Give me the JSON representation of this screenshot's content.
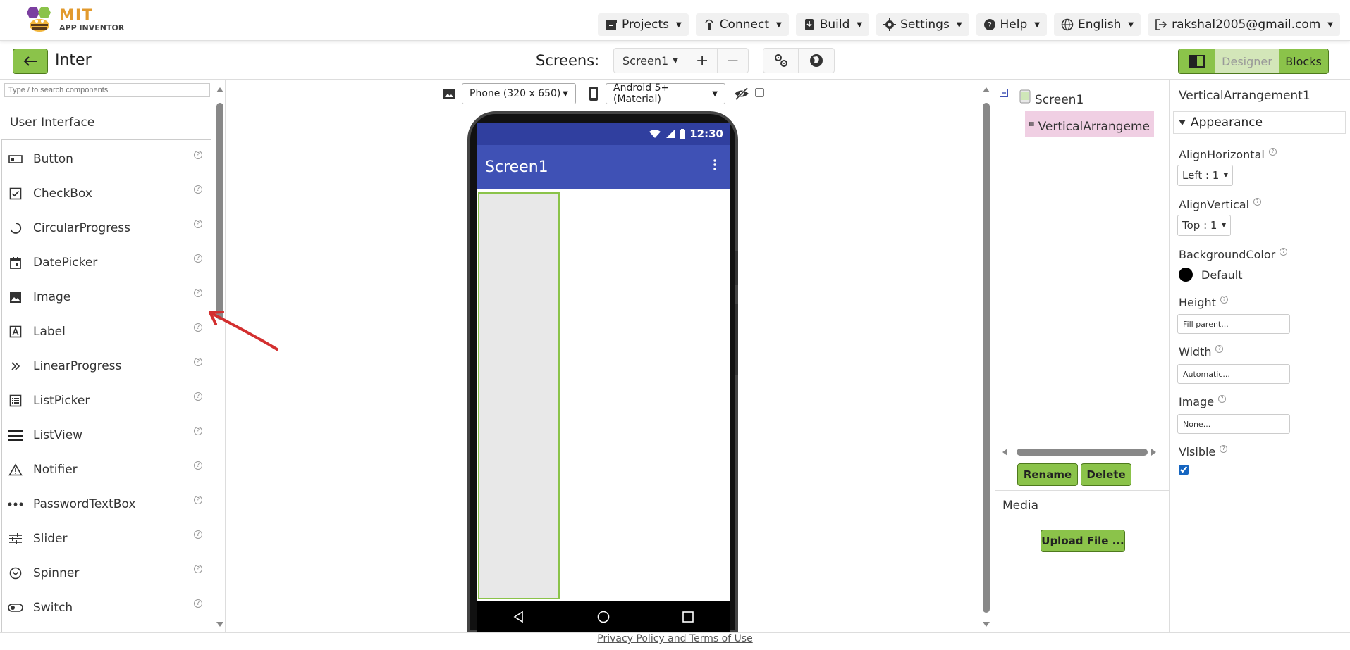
{
  "topbar": {
    "logo_mit": "MIT",
    "logo_sub": "APP INVENTOR",
    "nav": [
      {
        "label": "Projects",
        "icon": "archive-icon"
      },
      {
        "label": "Connect",
        "icon": "antenna-icon"
      },
      {
        "label": "Build",
        "icon": "download-box-icon"
      },
      {
        "label": "Settings",
        "icon": "gear-icon"
      },
      {
        "label": "Help",
        "icon": "help-circle-icon"
      },
      {
        "label": "English",
        "icon": "globe-icon"
      },
      {
        "label": "rakshal2005@gmail.com",
        "icon": "logout-icon"
      }
    ]
  },
  "toolbar": {
    "project_name": "Inter",
    "screens_label": "Screens:",
    "current_screen": "Screen1",
    "add": "+",
    "remove": "−",
    "designer": "Designer",
    "blocks": "Blocks"
  },
  "palette": {
    "search_placeholder": "Type / to search components",
    "category": "User Interface",
    "components": [
      {
        "label": "Button",
        "icon": "button-icon"
      },
      {
        "label": "CheckBox",
        "icon": "checkbox-icon"
      },
      {
        "label": "CircularProgress",
        "icon": "circular-progress-icon"
      },
      {
        "label": "DatePicker",
        "icon": "calendar-icon"
      },
      {
        "label": "Image",
        "icon": "image-icon"
      },
      {
        "label": "Label",
        "icon": "label-icon"
      },
      {
        "label": "LinearProgress",
        "icon": "double-chevron-icon"
      },
      {
        "label": "ListPicker",
        "icon": "list-picker-icon"
      },
      {
        "label": "ListView",
        "icon": "list-view-icon"
      },
      {
        "label": "Notifier",
        "icon": "warning-icon"
      },
      {
        "label": "PasswordTextBox",
        "icon": "password-dots-icon"
      },
      {
        "label": "Slider",
        "icon": "slider-icon"
      },
      {
        "label": "Spinner",
        "icon": "spinner-icon"
      },
      {
        "label": "Switch",
        "icon": "switch-icon"
      }
    ],
    "help_glyph": "?"
  },
  "viewer": {
    "device": "Phone (320 x 650)",
    "theme": "Android 5+ (Material)",
    "status_time": "12:30",
    "app_title": "Screen1"
  },
  "tree": {
    "root": "Screen1",
    "child": "VerticalArrangeme",
    "rename": "Rename",
    "delete": "Delete",
    "media_title": "Media",
    "upload": "Upload File ..."
  },
  "properties": {
    "component": "VerticalArrangement1",
    "section": "Appearance",
    "align_horizontal_label": "AlignHorizontal",
    "align_horizontal_value": "Left : 1",
    "align_vertical_label": "AlignVertical",
    "align_vertical_value": "Top : 1",
    "bg_color_label": "BackgroundColor",
    "bg_color_value": "Default",
    "height_label": "Height",
    "height_value": "Fill parent...",
    "width_label": "Width",
    "width_value": "Automatic...",
    "image_label": "Image",
    "image_value": "None...",
    "visible_label": "Visible",
    "visible_checked": true
  },
  "footer": {
    "link": "Privacy Policy and Terms of Use"
  },
  "colors": {
    "accent_green": "#8bc34a",
    "app_bar": "#3f51b5",
    "status_bar": "#303f9f",
    "selected_tree": "#f0cfe3",
    "annotation_arrow": "#d32f2f"
  }
}
